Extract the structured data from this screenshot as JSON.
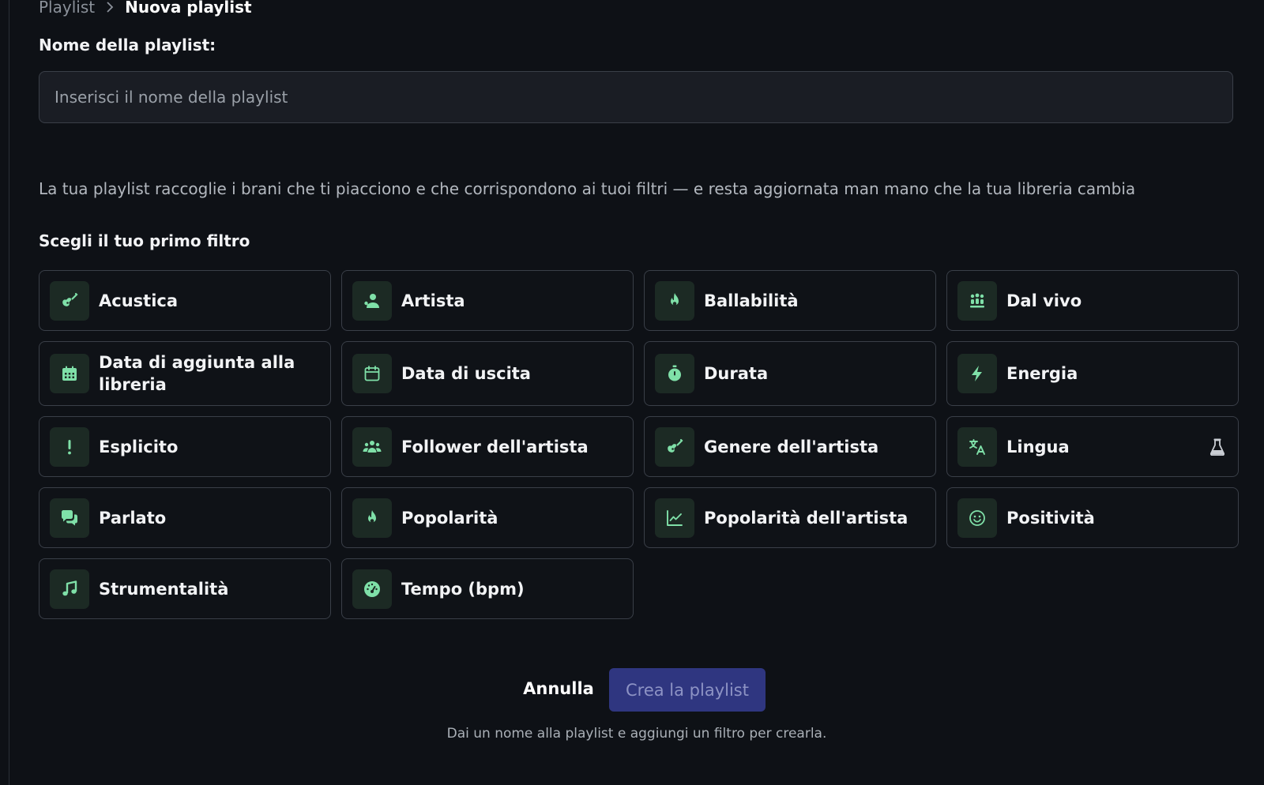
{
  "breadcrumb": {
    "parent": "Playlist",
    "current": "Nuova playlist"
  },
  "name_field": {
    "label": "Nome della playlist:",
    "placeholder": "Inserisci il nome della playlist",
    "value": ""
  },
  "description": "La tua playlist raccoglie i brani che ti piacciono e che corrispondono ai tuoi filtri — e resta aggiornata man mano che la tua libreria cambia",
  "filters_section": {
    "title": "Scegli il tuo primo filtro",
    "items": [
      {
        "label": "Acustica",
        "icon": "guitar-icon"
      },
      {
        "label": "Artista",
        "icon": "artist-icon"
      },
      {
        "label": "Ballabilità",
        "icon": "fire-icon"
      },
      {
        "label": "Dal vivo",
        "icon": "crowd-icon"
      },
      {
        "label": "Data di aggiunta alla libreria",
        "icon": "calendar-filled-icon"
      },
      {
        "label": "Data di uscita",
        "icon": "calendar-icon"
      },
      {
        "label": "Durata",
        "icon": "stopwatch-icon"
      },
      {
        "label": "Energia",
        "icon": "bolt-icon"
      },
      {
        "label": "Esplicito",
        "icon": "exclamation-icon"
      },
      {
        "label": "Follower dell'artista",
        "icon": "users-icon"
      },
      {
        "label": "Genere dell'artista",
        "icon": "guitar-icon"
      },
      {
        "label": "Lingua",
        "icon": "translate-icon",
        "badge": "flask-icon"
      },
      {
        "label": "Parlato",
        "icon": "chat-icon"
      },
      {
        "label": "Popolarità",
        "icon": "fire-icon"
      },
      {
        "label": "Popolarità dell'artista",
        "icon": "chart-line-icon"
      },
      {
        "label": "Positività",
        "icon": "smile-icon"
      },
      {
        "label": "Strumentalità",
        "icon": "music-note-icon"
      },
      {
        "label": "Tempo (bpm)",
        "icon": "gauge-icon"
      }
    ]
  },
  "actions": {
    "cancel_label": "Annulla",
    "create_label": "Crea la playlist",
    "hint": "Dai un nome alla playlist e aggiungi un filtro per crearla."
  },
  "colors": {
    "background": "#0e1116",
    "accent_icon": "#7fe0a8",
    "icon_box": "#1c2a24",
    "primary_button": "#2f3680"
  }
}
